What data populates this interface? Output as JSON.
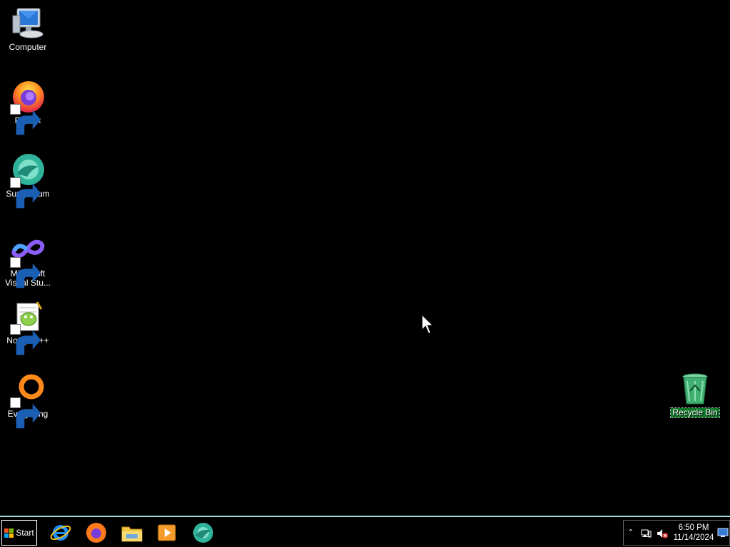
{
  "desktop": {
    "icons": [
      {
        "label": "Computer",
        "icon": "computer-icon"
      },
      {
        "label": "Firefox",
        "icon": "firefox-icon"
      },
      {
        "label": "Supermium",
        "icon": "supermium-icon"
      },
      {
        "label": "Microsoft Visual Stu...",
        "icon": "visual-studio-icon"
      },
      {
        "label": "Notepad++",
        "icon": "notepadplusplus-icon"
      },
      {
        "label": "Everything",
        "icon": "everything-icon"
      },
      {
        "label": "Recycle Bin",
        "icon": "recycle-bin-icon",
        "selected": true
      }
    ]
  },
  "taskbar": {
    "start_label": "Start",
    "pinned": [
      {
        "name": "Internet Explorer",
        "icon": "internet-explorer-icon"
      },
      {
        "name": "Firefox",
        "icon": "firefox-icon"
      },
      {
        "name": "File Explorer",
        "icon": "file-explorer-icon"
      },
      {
        "name": "Media Player",
        "icon": "media-player-icon"
      },
      {
        "name": "Supermium",
        "icon": "supermium-icon"
      }
    ],
    "tray": {
      "time": "6:50 PM",
      "date": "11/14/2024",
      "icons": [
        "show-hidden-icons-icon",
        "network-icon",
        "volume-muted-icon",
        "show-desktop-icon"
      ]
    }
  },
  "colors": {
    "desktop_background": "#000000",
    "taskbar_border": "#9fdfe8",
    "selection": "#0f7a2a"
  }
}
